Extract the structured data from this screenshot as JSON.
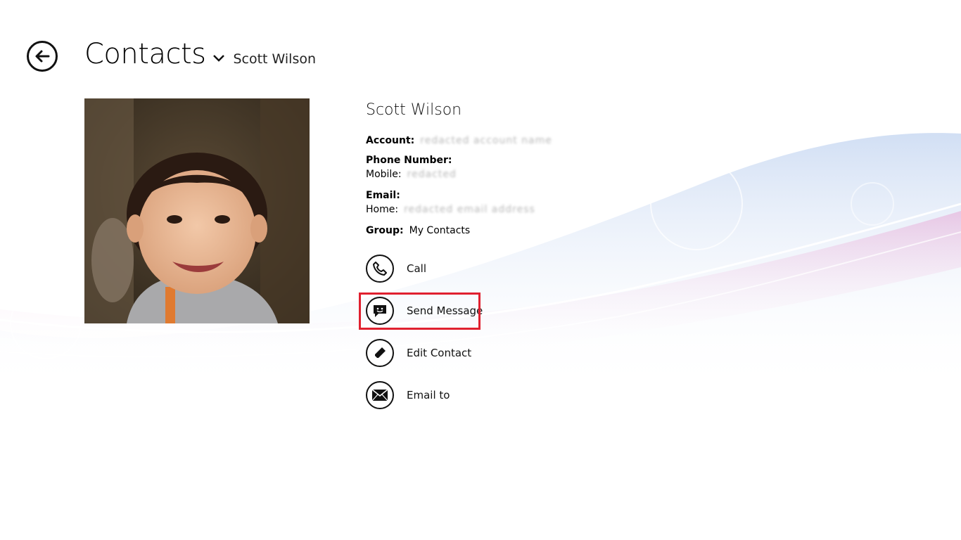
{
  "header": {
    "title": "Contacts",
    "subtitle": "Scott Wilson"
  },
  "contact": {
    "name": "Scott Wilson",
    "account_label": "Account:",
    "account_value": "redacted account name",
    "phone_label": "Phone Number:",
    "mobile_label": "Mobile:",
    "mobile_value": "redacted",
    "email_label": "Email:",
    "home_label": "Home:",
    "home_value": "redacted email address",
    "group_label": "Group:",
    "group_value": "My Contacts"
  },
  "actions": {
    "call": "Call",
    "send_message": "Send Message",
    "edit_contact": "Edit Contact",
    "email_to": "Email to"
  },
  "icons": {
    "back": "back-arrow-icon",
    "chevron": "chevron-down-icon",
    "call": "phone-icon",
    "message": "message-icon",
    "edit": "pencil-icon",
    "email": "envelope-icon"
  },
  "colors": {
    "highlight": "#e0202f",
    "wave_blue": "#c9d9f2",
    "wave_pink": "#e6a6d4"
  }
}
